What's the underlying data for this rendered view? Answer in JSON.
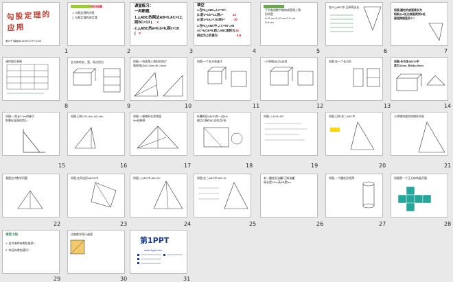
{
  "app": {
    "title": "幻灯片浏览视图"
  },
  "slides": [
    {
      "num": "1",
      "title": "勾股定理的应用",
      "footer": "第1PPT模板网-WWW.1PPT.COM"
    },
    {
      "num": "2",
      "heading": "知识回顾",
      "lines": [
        "1. 勾股定理的内容",
        "2. 勾股定理的逆定理"
      ]
    },
    {
      "num": "3",
      "heading": "课堂练习：",
      "lines": [
        "一判断题.",
        "1.△ABC的两边AB=5,AC=12,",
        "则BC=13 (",
        "2.△ABC的a=6,b=8,则c=10",
        "("
      ],
      "marks": [
        "×",
        "×"
      ]
    },
    {
      "num": "4",
      "heading": "填空",
      "lines": [
        "1.在Rt△ABC,∠C=90°,",
        "(1)若a=5,b=12,则c=",
        "(2)若a=15,c=25,则b=",
        "2.在Rt△ABC中,∠C=90°,AB",
        "AC=6,CB=8,则△ABC面积为",
        "斜边为上的高为"
      ],
      "answers": [
        "13",
        "20",
        "24",
        "4.8"
      ]
    },
    {
      "num": "5",
      "lines": [
        "下列各组数中能构成直角三角",
        "形的是",
        "A.11 cm  B.10 cm  C.5 cm",
        "D.6 cm"
      ]
    },
    {
      "num": "6",
      "lines": [
        "在Rt△ABC中,已知两边长"
      ]
    },
    {
      "num": "7",
      "lines": [
        "如图,圆柱的底面周长为",
        "蚂蚁从A处沿侧面爬到B处",
        "最短路程是多少?"
      ]
    },
    {
      "num": "8",
      "lines": [
        "请你填写表格"
      ]
    },
    {
      "num": "9",
      "lines": [
        "长方体的长、宽、高分别为"
      ]
    },
    {
      "num": "10",
      "lines": [
        "如图,一块直角三角形的纸片",
        "两直角边AC=6cm,BC=8cm"
      ]
    },
    {
      "num": "11",
      "lines": [
        "如图,一个长方体盒子"
      ]
    },
    {
      "num": "12",
      "lines": [
        "一只蚂蚁从点A出发"
      ]
    },
    {
      "num": "13",
      "lines": [
        "如图,在一个长方形"
      ]
    },
    {
      "num": "14",
      "lines": [
        "如图,长方体ABCD中",
        "宽为10cm, 长AB=20cm"
      ]
    },
    {
      "num": "15",
      "lines": [
        "如图,一架长2.5m的梯子",
        "斜靠在竖直的墙上"
      ]
    },
    {
      "num": "16",
      "lines": [
        "如图,已知:CD=6m, AD=8m"
      ]
    },
    {
      "num": "17",
      "lines": [
        "如图,一根旗杆在离地面",
        "9m处断裂"
      ]
    },
    {
      "num": "18",
      "lines": [
        "折叠矩形ABCD的一边AD",
        "使点D落在BC边的点F处"
      ]
    },
    {
      "num": "19",
      "lines": [
        "如图,∠ACB=90°"
      ]
    },
    {
      "num": "20",
      "lines": [
        "如图,已知:在△ABC中"
      ]
    },
    {
      "num": "21",
      "lines": [
        "小明想知道学校旗杆的高"
      ]
    },
    {
      "num": "22",
      "lines": [
        "我国古代数学问题"
      ]
    },
    {
      "num": "23",
      "lines": [
        "如图,在四边形ABCD中"
      ]
    },
    {
      "num": "24",
      "lines": [
        "如图,△ABC中,AB=AC"
      ]
    },
    {
      "num": "25",
      "lines": [
        "如图,在△ABC中,AB=15"
      ]
    },
    {
      "num": "26",
      "lines": [
        "有一圆柱形油罐,已知油罐",
        "周长是12m,高AB是5m"
      ]
    },
    {
      "num": "27",
      "lines": [
        "如图,一个圆柱形纸筒"
      ]
    },
    {
      "num": "28",
      "lines": [
        "如图是一个正方体的展开图"
      ]
    },
    {
      "num": "29",
      "heading": "课堂小结",
      "lines": [
        "1. 这节课你有哪些收获?",
        "2. 你还有哪些疑问?"
      ]
    },
    {
      "num": "30",
      "lines": [
        "印度数学家什迦逻"
      ]
    },
    {
      "num": "31",
      "logo": "第1PPT",
      "lines": [
        "www.1ppt.com"
      ]
    }
  ]
}
